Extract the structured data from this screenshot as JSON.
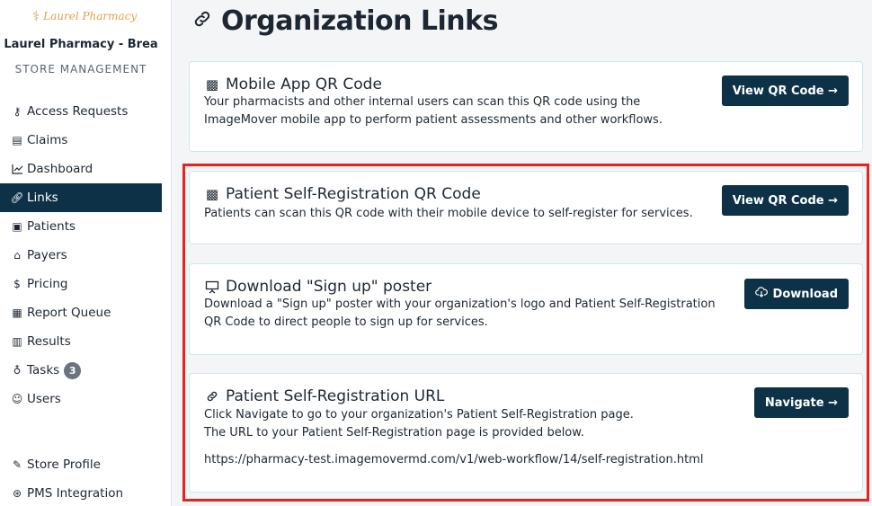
{
  "sidebar": {
    "logo_text": "Laurel Pharmacy",
    "store_name": "Laurel Pharmacy - Brea",
    "store_subtitle": "STORE MANAGEMENT",
    "items": [
      {
        "label": "Access Requests",
        "icon": "people-key-icon"
      },
      {
        "label": "Claims",
        "icon": "document-list-icon"
      },
      {
        "label": "Dashboard",
        "icon": "line-chart-icon"
      },
      {
        "label": "Links",
        "icon": "link-icon",
        "active": true
      },
      {
        "label": "Patients",
        "icon": "id-card-icon"
      },
      {
        "label": "Payers",
        "icon": "bank-icon"
      },
      {
        "label": "Pricing",
        "icon": "price-tag-icon"
      },
      {
        "label": "Report Queue",
        "icon": "report-icon"
      },
      {
        "label": "Results",
        "icon": "results-icon"
      },
      {
        "label": "Tasks",
        "icon": "lightbulb-icon",
        "badge": "3"
      },
      {
        "label": "Users",
        "icon": "users-icon"
      }
    ],
    "bottom_items": [
      {
        "label": "Store Profile",
        "icon": "pencil-icon"
      },
      {
        "label": "PMS Integration",
        "icon": "integration-icon"
      }
    ]
  },
  "page": {
    "title": "Organization Links"
  },
  "cards": [
    {
      "title": "Mobile App QR Code",
      "description": "Your pharmacists and other internal users can scan this QR code using the ImageMover mobile app to perform patient assessments and other workflows.",
      "button": "View QR Code →"
    },
    {
      "title": "Patient Self-Registration QR Code",
      "description": "Patients can scan this QR code with their mobile device to self-register for services.",
      "button": "View QR Code →"
    },
    {
      "title": "Download \"Sign up\" poster",
      "description": "Download a \"Sign up\" poster with your organization's logo and Patient Self-Registration QR Code to direct people to sign up for services.",
      "button": "Download"
    },
    {
      "title": "Patient Self-Registration URL",
      "description_line1": "Click Navigate to go to your organization's Patient Self-Registration page.",
      "description_line2": "The URL to your Patient Self-Registration page is provided below.",
      "url": "https://pharmacy-test.imagemovermd.com/v1/web-workflow/14/self-registration.html",
      "button": "Navigate →"
    }
  ],
  "colors": {
    "primary": "#0d3146",
    "highlight": "#e8231e",
    "logo": "#e0a24a"
  }
}
